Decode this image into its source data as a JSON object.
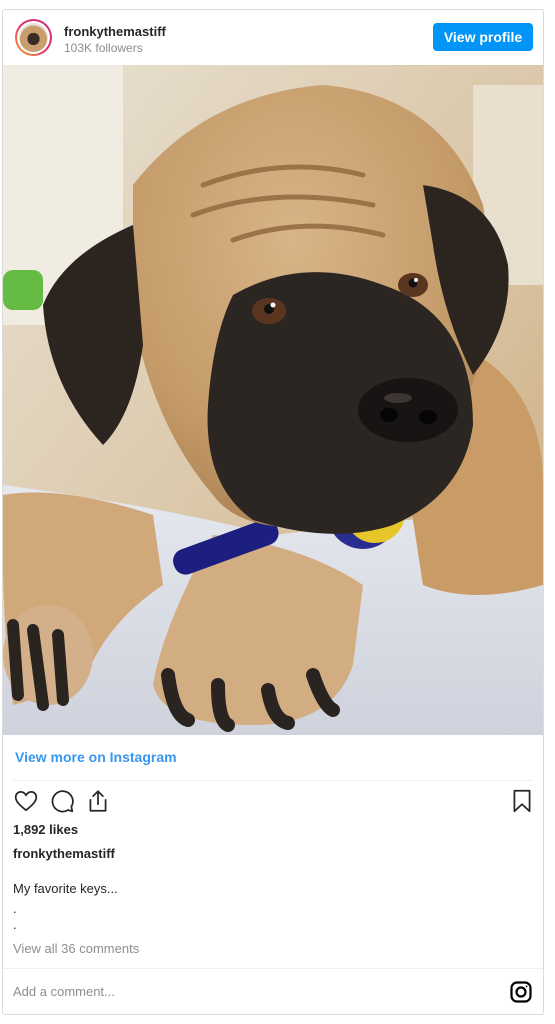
{
  "header": {
    "username": "fronkythemastiff",
    "followers": "103K followers",
    "view_profile_label": "View profile"
  },
  "post": {
    "image_subject": "mastiff-dog-with-toy-keys-photo",
    "view_more_label": "View more on Instagram",
    "likes": "1,892 likes",
    "caption_user": "fronkythemastiff",
    "caption_lines": [
      "My favorite keys...",
      ".",
      "."
    ],
    "view_comments": "View all 36 comments",
    "add_comment_placeholder": "Add a comment..."
  },
  "icons": {
    "like": "heart-icon",
    "comment": "comment-icon",
    "share": "share-icon",
    "save": "bookmark-icon",
    "instagram": "instagram-icon"
  },
  "colors": {
    "accent": "#0095f6",
    "link": "#3897f0",
    "muted": "#8e8e8e",
    "text": "#262626"
  }
}
